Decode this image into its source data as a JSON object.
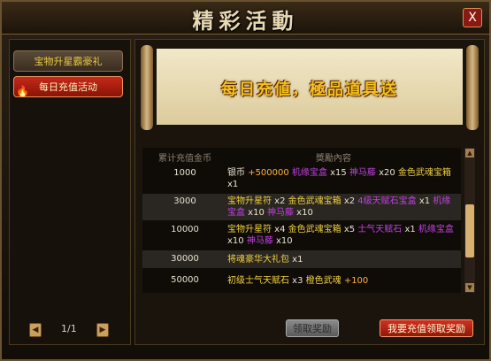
{
  "window": {
    "title": "精彩活動",
    "close_label": "X"
  },
  "sidebar": {
    "items": [
      {
        "label": "宝物升星霸豪礼"
      },
      {
        "label": "每日充值活动"
      }
    ],
    "pager": {
      "prev": "◀",
      "text": "1/1",
      "next": "▶"
    }
  },
  "banner": {
    "text": "每日充値，極品道具送"
  },
  "table": {
    "headers": {
      "amount": "累计充值金币",
      "rewards": "獎勵內容"
    },
    "rows": [
      {
        "amount": "1000",
        "parts": [
          {
            "t": "银币 ",
            "c": "w"
          },
          {
            "t": "+500000 ",
            "c": "o"
          },
          {
            "t": "机缘宝盒",
            "c": "p"
          },
          {
            "t": " x15 ",
            "c": "w"
          },
          {
            "t": "神马藤",
            "c": "p"
          },
          {
            "t": " x20 ",
            "c": "w"
          },
          {
            "t": "金色武魂宝箱",
            "c": "y"
          },
          {
            "t": " x1",
            "c": "w"
          }
        ]
      },
      {
        "amount": "3000",
        "parts": [
          {
            "t": "宝物升星符",
            "c": "y"
          },
          {
            "t": " x2 ",
            "c": "w"
          },
          {
            "t": "金色武魂宝箱",
            "c": "y"
          },
          {
            "t": " x2 ",
            "c": "w"
          },
          {
            "t": "4级天赋石宝盒",
            "c": "p"
          },
          {
            "t": " x1 ",
            "c": "w"
          },
          {
            "t": "机缘宝盒",
            "c": "p"
          },
          {
            "t": " x10 ",
            "c": "w"
          },
          {
            "t": "神马藤",
            "c": "p"
          },
          {
            "t": " x10",
            "c": "w"
          }
        ]
      },
      {
        "amount": "10000",
        "parts": [
          {
            "t": "宝物升星符",
            "c": "y"
          },
          {
            "t": " x4 ",
            "c": "w"
          },
          {
            "t": "金色武魂宝箱",
            "c": "y"
          },
          {
            "t": " x5 ",
            "c": "w"
          },
          {
            "t": "士气天赋石",
            "c": "p"
          },
          {
            "t": " x1 ",
            "c": "w"
          },
          {
            "t": "机缘宝盒",
            "c": "p"
          },
          {
            "t": " x10 ",
            "c": "w"
          },
          {
            "t": "神马藤",
            "c": "p"
          },
          {
            "t": " x10",
            "c": "w"
          }
        ]
      },
      {
        "amount": "30000",
        "parts": [
          {
            "t": "将魂豪华大礼包",
            "c": "y"
          },
          {
            "t": " x1",
            "c": "w"
          }
        ]
      },
      {
        "amount": "50000",
        "parts": [
          {
            "t": "初级士气天赋石",
            "c": "y"
          },
          {
            "t": " x3 ",
            "c": "w"
          },
          {
            "t": "橙色武魂",
            "c": "y"
          },
          {
            "t": " +100",
            "c": "o"
          }
        ]
      }
    ]
  },
  "buttons": {
    "claim": "领取奖励",
    "recharge": "我要充值领取奖励"
  }
}
